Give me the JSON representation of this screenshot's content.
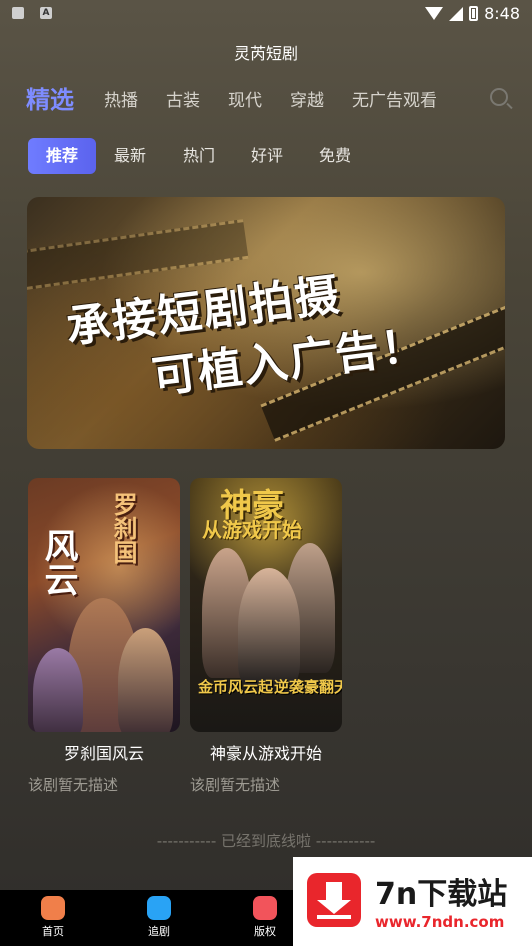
{
  "status_bar": {
    "time": "8:48"
  },
  "header": {
    "title": "灵芮短剧"
  },
  "category_tabs": [
    {
      "label": "精选",
      "active": true
    },
    {
      "label": "热播"
    },
    {
      "label": "古装"
    },
    {
      "label": "现代"
    },
    {
      "label": "穿越"
    },
    {
      "label": "无广告观看"
    }
  ],
  "sub_tabs": [
    {
      "label": "推荐",
      "active": true
    },
    {
      "label": "最新"
    },
    {
      "label": "热门"
    },
    {
      "label": "好评"
    },
    {
      "label": "免费"
    }
  ],
  "banner": {
    "line1": "承接短剧拍摄",
    "line2": "可植入广告！"
  },
  "dramas": [
    {
      "title": "罗刹国风云",
      "description": "该剧暂无描述",
      "poster_text_a": "风云",
      "poster_text_b": "罗刹国"
    },
    {
      "title": "神豪从游戏开始",
      "description": "该剧暂无描述",
      "poster_text_a": "神豪",
      "poster_text_b": "从游戏开始",
      "poster_text_c": "金币风云起",
      "poster_text_d": "逆袭豪翻天"
    }
  ],
  "end_text": "----------- 已经到底线啦 -----------",
  "bottom_nav": [
    {
      "label": "首页",
      "icon": "home-icon",
      "color": "#f07f4a"
    },
    {
      "label": "追剧",
      "icon": "heart-icon",
      "color": "#29a3f5"
    },
    {
      "label": "版权",
      "icon": "shop-icon",
      "color": "#f2545b"
    }
  ],
  "watermark": {
    "title": "7n下载站",
    "url": "www.7ndn.com"
  },
  "colors": {
    "accent": "#6f7cff",
    "watermark_red": "#e9262c"
  }
}
